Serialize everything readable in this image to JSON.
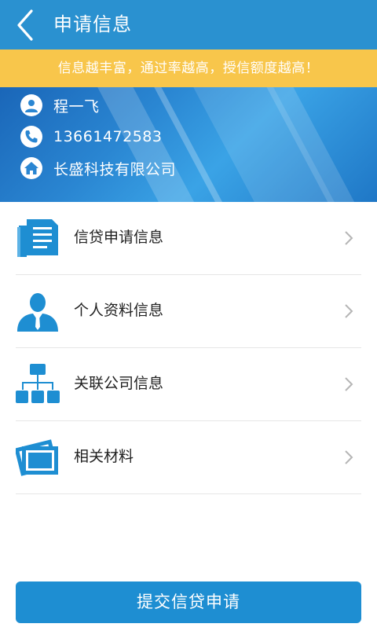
{
  "header": {
    "title": "申请信息",
    "back_icon": "chevron-left-icon"
  },
  "tip": {
    "text": "信息越丰富，通过率越高，授信额度越高！"
  },
  "profile": {
    "name": "程一飞",
    "phone": "13661472583",
    "company": "长盛科技有限公司",
    "icons": {
      "name": "user-icon",
      "phone": "phone-icon",
      "company": "home-icon"
    }
  },
  "menu": [
    {
      "label": "信贷申请信息",
      "icon": "document-icon"
    },
    {
      "label": "个人资料信息",
      "icon": "person-icon"
    },
    {
      "label": "关联公司信息",
      "icon": "org-chart-icon"
    },
    {
      "label": "相关材料",
      "icon": "photo-frame-icon"
    }
  ],
  "submit": {
    "label": "提交信贷申请"
  },
  "colors": {
    "primary": "#2a91d0",
    "accent_yellow": "#f8c64b",
    "icon_blue": "#1e8ed2",
    "submit": "#1e8ed2"
  }
}
